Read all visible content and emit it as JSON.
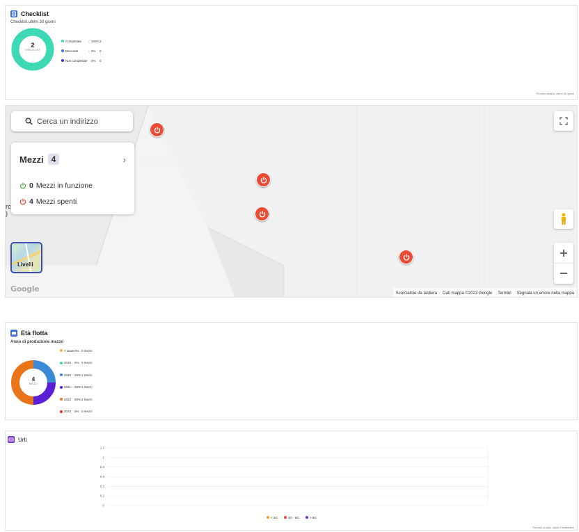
{
  "checklist": {
    "title": "Checklist",
    "subtitle": "Checklist ultimi 30 giorni",
    "center_value": "2",
    "center_label": "CHECKLIST",
    "legend": [
      {
        "label": "Completate",
        "arrow": "↑",
        "percent": "100%",
        "count": "2",
        "color": "#3dd8b4",
        "arrow_color": "#e94b35",
        "fraction": 1.0
      },
      {
        "label": "Bloccanti",
        "arrow": "↓",
        "percent": "0%",
        "count": "0",
        "color": "#3b78d8",
        "arrow_color": "#e94b35",
        "fraction": 0.0
      },
      {
        "label": "Non completate",
        "arrow": "",
        "percent": "0%",
        "count": "0",
        "color": "#5b1fd6",
        "arrow_color": "#e94b35",
        "fraction": 0.0
      }
    ],
    "footnote": "Periodo analisi: ultimi 30 giorni"
  },
  "map": {
    "search_placeholder": "Cerca un indirizzo",
    "mezzi_title": "Mezzi",
    "mezzi_count": "4",
    "running_count": "0",
    "running_label": "Mezzi in funzione",
    "off_count": "4",
    "off_label": "Mezzi spenti",
    "layers_label": "Livelli",
    "google_logo": "Google",
    "partial_label": "rc\n)",
    "attribution": [
      "Scorciatoie da tastiera",
      "Dati mappa ©2023 Google",
      "Termini",
      "Segnala un errore nella mappa"
    ],
    "colors": {
      "marker": "#e94b35",
      "running": "#4caf50",
      "off": "#e94b35"
    }
  },
  "fleet_age": {
    "title": "Età flotta",
    "subtitle": "Anno di produzione mezzo",
    "center_value": "4",
    "center_label": "MEZZI",
    "legend": [
      {
        "label": "< 2018",
        "percent": "0%",
        "count": "0 mezzi",
        "color": "#e2b93b",
        "fraction": 0.0
      },
      {
        "label": "2019",
        "percent": "0%",
        "count": "0 mezzi",
        "color": "#3dd8b4",
        "fraction": 0.0
      },
      {
        "label": "2020",
        "percent": "25%",
        "count": "1 mezzi",
        "color": "#3b8ad8",
        "fraction": 0.25
      },
      {
        "label": "2021",
        "percent": "25%",
        "count": "1 mezzi",
        "color": "#5b1fd6",
        "fraction": 0.25
      },
      {
        "label": "2022",
        "percent": "50%",
        "count": "2 mezzi",
        "color": "#e8751a",
        "fraction": 0.5
      },
      {
        "label": "2023",
        "percent": "0%",
        "count": "0 mezzi",
        "color": "#d63a3a",
        "fraction": 0.0
      }
    ]
  },
  "urti": {
    "title": "Urti",
    "footnote": "Periodo analisi: ultimi 6 settimane",
    "chart_data": {
      "type": "line",
      "title": "",
      "y_ticks": [
        "1.2",
        "1",
        "0.8",
        "0.6",
        "0.4",
        "0.2",
        "0"
      ],
      "ylim": [
        0,
        1.2
      ],
      "grid": true,
      "series": [
        {
          "name": "< 3G",
          "color": "#f5a623",
          "values": []
        },
        {
          "name": "3G - 8G",
          "color": "#e94b35",
          "values": []
        },
        {
          "name": "> 8G",
          "color": "#7b2fd6",
          "values": []
        }
      ],
      "legend_position": "bottom-center"
    }
  }
}
